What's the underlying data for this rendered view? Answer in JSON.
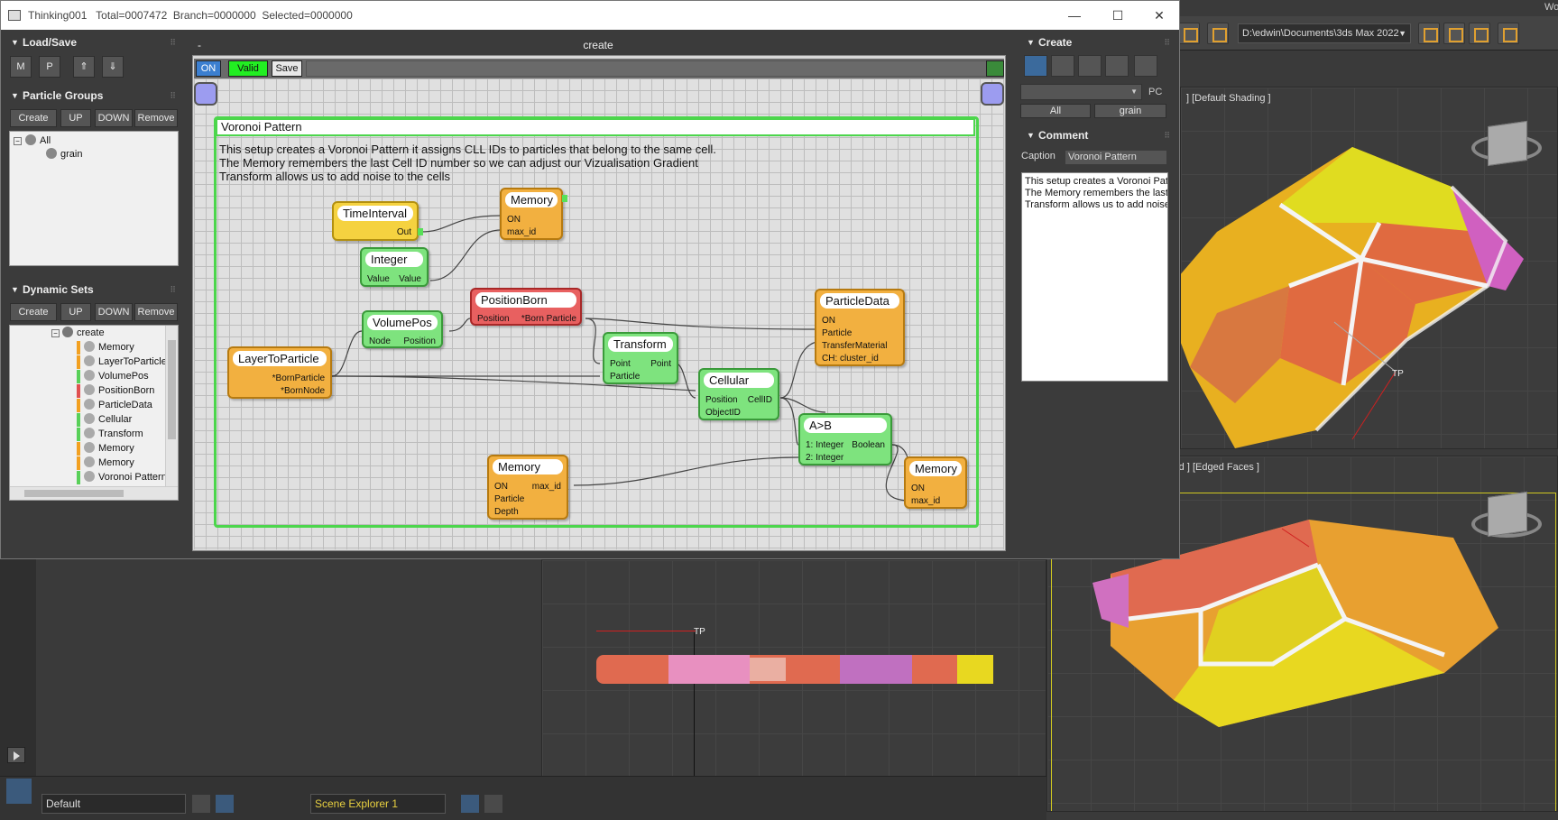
{
  "window": {
    "title": "Thinking001   Total=0007472  Branch=0000000  Selected=0000000",
    "minimize": "—",
    "maximize": "☐",
    "close": "✕"
  },
  "load_save": {
    "title": "Load/Save",
    "buttons": [
      "M",
      "P"
    ]
  },
  "particle_groups": {
    "title": "Particle Groups",
    "buttons": [
      "Create",
      "UP",
      "DOWN",
      "Remove"
    ],
    "tree": [
      "All",
      "grain"
    ]
  },
  "dynamic_sets": {
    "title": "Dynamic Sets",
    "buttons": [
      "Create",
      "UP",
      "DOWN",
      "Remove"
    ],
    "tree": [
      {
        "label": "create",
        "color": ""
      },
      {
        "label": "Memory",
        "color": "#f2a020"
      },
      {
        "label": "LayerToParticle",
        "color": "#f2a020"
      },
      {
        "label": "VolumePos",
        "color": "#58d058"
      },
      {
        "label": "PositionBorn",
        "color": "#e05050"
      },
      {
        "label": "ParticleData",
        "color": "#f2a020"
      },
      {
        "label": "Cellular",
        "color": "#58d058"
      },
      {
        "label": "Transform",
        "color": "#58d058"
      },
      {
        "label": "Memory",
        "color": "#f2a020"
      },
      {
        "label": "Memory",
        "color": "#f2a020"
      },
      {
        "label": "Voronoi Pattern",
        "color": "#58d058"
      }
    ]
  },
  "editor": {
    "header_left": "-",
    "header": "create",
    "toolbar": {
      "on": "ON",
      "valid": "Valid",
      "save": "Save"
    }
  },
  "group": {
    "title": "Voronoi Pattern",
    "description": "This setup creates a Voronoi Pattern it assigns CLL IDs to particles that belong to the same cell.\nThe Memory remembers the last Cell ID number so we can adjust our Vizualisation Gradient\nTransform allows us to add noise to the cells"
  },
  "nodes": {
    "timeinterval": {
      "title": "TimeInterval",
      "out": "Out"
    },
    "memory1": {
      "title": "Memory",
      "on": "ON",
      "max_id": "max_id"
    },
    "integer": {
      "title": "Integer",
      "in": "Value",
      "out": "Value"
    },
    "volumepos": {
      "title": "VolumePos",
      "node": "Node",
      "position": "Position"
    },
    "positionborn": {
      "title": "PositionBorn",
      "position": "Position",
      "born": "*Born Particle"
    },
    "particledata": {
      "title": "ParticleData",
      "rows": [
        "ON",
        "Particle",
        "TransferMaterial",
        "CH: cluster_id"
      ]
    },
    "layertoparticle": {
      "title": "LayerToParticle",
      "rows": [
        "*BornParticle",
        "*BornNode"
      ]
    },
    "transform": {
      "title": "Transform",
      "point_in": "Point",
      "point_out": "Point",
      "particle": "Particle"
    },
    "cellular": {
      "title": "Cellular",
      "position": "Position",
      "cellid": "CellID",
      "objectid": "ObjectID"
    },
    "agtb": {
      "title": "A>B",
      "in1": "1: Integer",
      "out": "Boolean",
      "in2": "2: Integer"
    },
    "memory2": {
      "title": "Memory",
      "on": "ON",
      "max_id": "max_id",
      "particle": "Particle",
      "depth": "Depth"
    },
    "memory3": {
      "title": "Memory",
      "on": "ON",
      "max_id": "max_id"
    }
  },
  "create_panel": {
    "title": "Create",
    "pc": "PC",
    "tabs": [
      "All",
      "grain"
    ]
  },
  "comment_panel": {
    "title": "Comment",
    "caption_label": "Caption",
    "caption_value": "Voronoi Pattern",
    "text": "This setup creates a Voronoi Patt\nThe Memory remembers the last C\nTransform allows us to add noise"
  },
  "max": {
    "path": "D:\\edwin\\Documents\\3ds Max 2022",
    "wo": "Wo",
    "vp_top_label": "] [Default Shading ]",
    "vp_bottom_label": "rd ] [Edged Faces ]",
    "tp_label": "TP",
    "tp_label2": "TP",
    "layer_select": "Default",
    "scene_explorer": "Scene Explorer 1"
  },
  "colors": {
    "valid": "#22ee22",
    "on": "#3c7fd0",
    "group_border": "#4cd64c"
  }
}
